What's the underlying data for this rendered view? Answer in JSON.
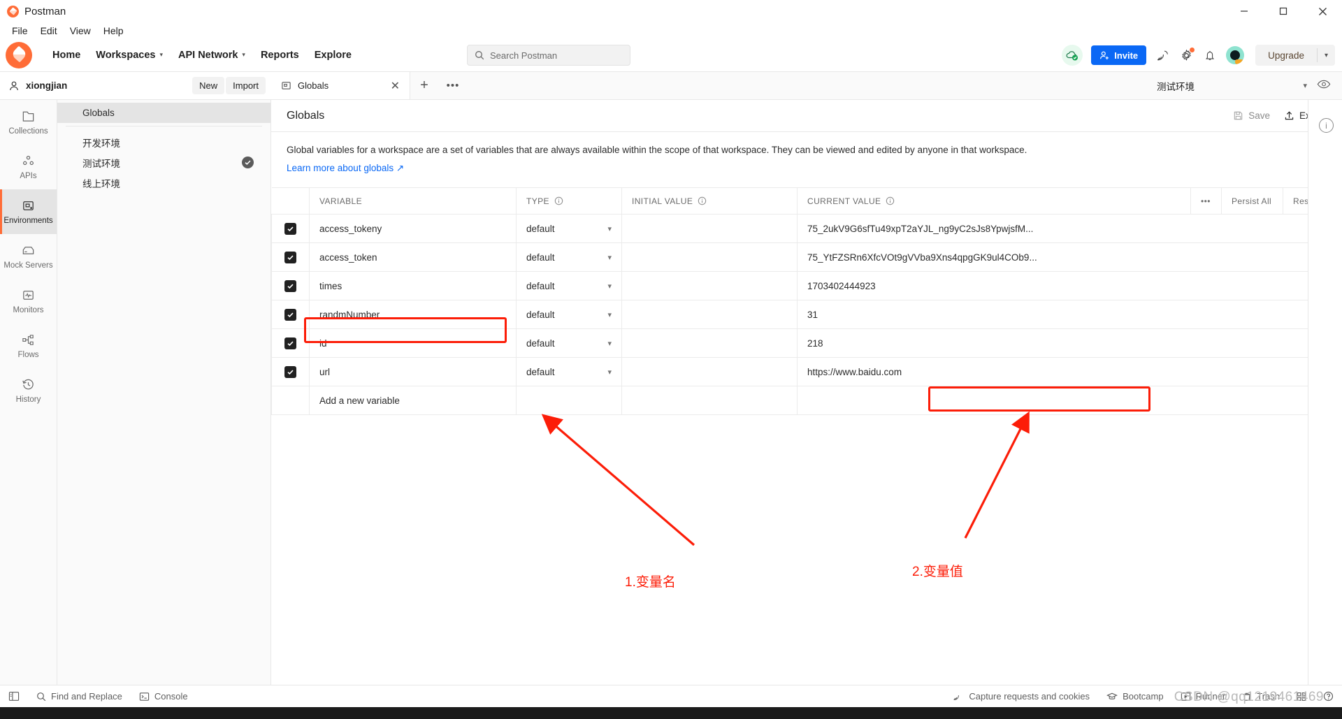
{
  "window": {
    "app_title": "Postman",
    "minimize": "minimize-icon",
    "maximize": "maximize-icon",
    "close": "close-icon"
  },
  "menubar": {
    "items": [
      "File",
      "Edit",
      "View",
      "Help"
    ]
  },
  "topnav": {
    "items": [
      {
        "label": "Home",
        "has_caret": false
      },
      {
        "label": "Workspaces",
        "has_caret": true
      },
      {
        "label": "API Network",
        "has_caret": true
      },
      {
        "label": "Reports",
        "has_caret": false
      },
      {
        "label": "Explore",
        "has_caret": false
      }
    ],
    "search_placeholder": "Search Postman",
    "invite_label": "Invite",
    "upgrade_label": "Upgrade",
    "icons": [
      "cloud-check-icon",
      "satellite-icon",
      "gear-icon",
      "bell-icon",
      "avatar-icon"
    ]
  },
  "workspace": {
    "user": "xiongjian",
    "new_button": "New",
    "import_button": "Import"
  },
  "environments": {
    "filter_placeholder": "",
    "globals_label": "Globals",
    "items": [
      {
        "label": "开发环境",
        "active": false
      },
      {
        "label": "测试环境",
        "active": true
      },
      {
        "label": "线上环境",
        "active": false
      }
    ]
  },
  "tabbar": {
    "tabs": [
      {
        "label": "Globals"
      }
    ],
    "selected_environment": "测试环境"
  },
  "document": {
    "title": "Globals",
    "save_label": "Save",
    "export_label": "Export",
    "description": "Global variables for a workspace are a set of variables that are always available within the scope of that workspace. They can be viewed and edited by anyone in that workspace.",
    "learn_more": "Learn more about globals ↗"
  },
  "table": {
    "headers": {
      "variable": "VARIABLE",
      "type": "TYPE",
      "initial_value": "INITIAL VALUE",
      "current_value": "CURRENT VALUE",
      "persist_all": "Persist All",
      "reset_all": "Reset All"
    },
    "rows": [
      {
        "checked": true,
        "variable": "access_tokeny",
        "type": "default",
        "initial_value": "",
        "current_value": "75_2ukV9G6sfTu49xpT2aYJL_ng9yC2sJs8YpwjsfM...",
        "highlight_variable": false,
        "highlight_value": false
      },
      {
        "checked": true,
        "variable": "access_token",
        "type": "default",
        "initial_value": "",
        "current_value": "75_YtFZSRn6XfcVOt9gVVba9Xns4qpgGK9ul4COb9...",
        "highlight_variable": false,
        "highlight_value": false
      },
      {
        "checked": true,
        "variable": "times",
        "type": "default",
        "initial_value": "",
        "current_value": "1703402444923",
        "highlight_variable": false,
        "highlight_value": false
      },
      {
        "checked": true,
        "variable": "randmNumber",
        "type": "default",
        "initial_value": "",
        "current_value": "31",
        "highlight_variable": false,
        "highlight_value": false
      },
      {
        "checked": true,
        "variable": "id",
        "type": "default",
        "initial_value": "",
        "current_value": "218",
        "highlight_variable": false,
        "highlight_value": false
      },
      {
        "checked": true,
        "variable": "url",
        "type": "default",
        "initial_value": "",
        "current_value": "https://www.baidu.com",
        "highlight_variable": true,
        "highlight_value": true
      }
    ],
    "add_row_placeholder": "Add a new variable"
  },
  "annotations": [
    {
      "text": "1.变量名",
      "color": "#fc1d08"
    },
    {
      "text": "2.变量值",
      "color": "#fc1d08"
    }
  ],
  "statusbar": {
    "left": [
      {
        "label": "",
        "icon": "sidebar-toggle-icon"
      },
      {
        "label": "Find and Replace",
        "icon": "search-icon"
      },
      {
        "label": "Console",
        "icon": "console-icon"
      }
    ],
    "right": [
      {
        "label": "Capture requests and cookies",
        "icon": "satellite-icon"
      },
      {
        "label": "Bootcamp",
        "icon": "graduation-cap-icon"
      },
      {
        "label": "Runner",
        "icon": "runner-icon"
      },
      {
        "label": "Trash",
        "icon": "trash-icon"
      },
      {
        "label": "",
        "icon": "grid-icon"
      },
      {
        "label": "",
        "icon": "help-icon"
      }
    ]
  },
  "watermark": "CSDN @qq1219461469",
  "colors": {
    "accent": "#ff6c37",
    "blue": "#0a68f5",
    "annotation_red": "#fc1d08",
    "header_text": "#6b6b6b"
  }
}
